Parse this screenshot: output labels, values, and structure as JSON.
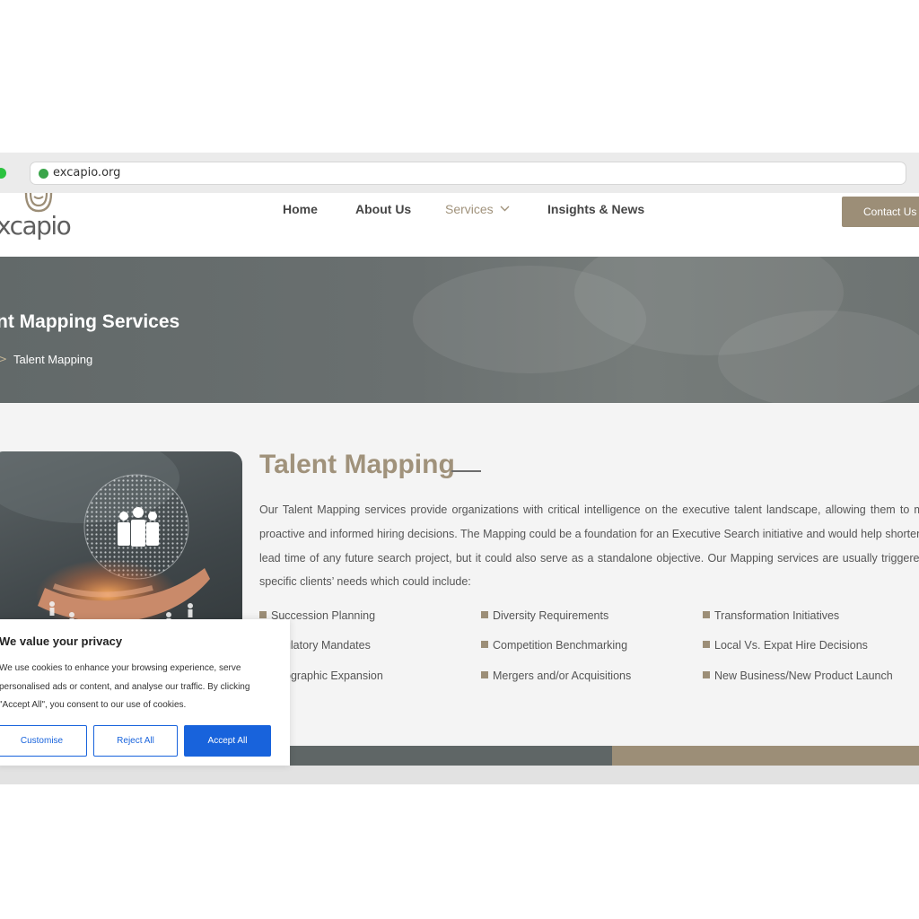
{
  "browser": {
    "url": "excapio.org"
  },
  "header": {
    "logo_text": "xcapio",
    "nav": [
      {
        "label": "Home"
      },
      {
        "label": "About Us"
      },
      {
        "label": "Services"
      },
      {
        "label": "Insights & News"
      }
    ],
    "contact_label": "Contact Us"
  },
  "hero": {
    "title": "nt Mapping Services",
    "breadcrumb_sep": ">",
    "breadcrumb_current": "Talent Mapping"
  },
  "main": {
    "title": "Talent Mapping",
    "paragraph": "Our Talent Mapping services provide organizations with critical intelligence on the executive talent landscape, allowing them to make proactive and informed hiring decisions. The Mapping could be a foundation for an Executive Search initiative and would help shorten the lead time of any future search project, but it could also serve as a standalone objective. Our Mapping services are usually triggered by specific clients’ needs which could include:",
    "needs": [
      "Succession Planning",
      "Diversity Requirements",
      "Transformation Initiatives",
      "gulatory Mandates",
      "Competition Benchmarking",
      "Local Vs. Expat Hire Decisions",
      "ographic Expansion",
      "Mergers and/or Acquisitions",
      "New Business/New Product Launch"
    ]
  },
  "cookie": {
    "title": "We value your privacy",
    "text": "We use cookies to enhance your browsing experience, serve personalised ads or content, and analyse our traffic. By clicking \"Accept All\", you consent to our use of cookies.",
    "customise": "Customise",
    "reject": "Reject All",
    "accept": "Accept All"
  },
  "colors": {
    "brand_gold": "#9c8e77",
    "hero_gray": "#676e6e",
    "cookie_blue": "#1863dc"
  }
}
